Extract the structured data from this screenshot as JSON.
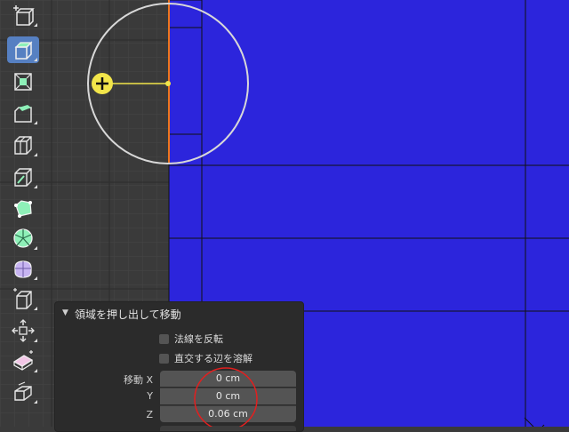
{
  "colors": {
    "viewport_bg": "#3a3a3a",
    "face_blue": "#2c25dc",
    "edge_black": "#111111",
    "active_tool": "#5680c2",
    "gizmo_yellow": "#f2e54a",
    "annotation_red": "#e21f1f"
  },
  "toolbar": {
    "tools": [
      {
        "icon": "add-cube-icon",
        "active": false
      },
      {
        "icon": "extrude-region-icon",
        "active": true
      },
      {
        "icon": "inset-faces-icon",
        "active": false
      },
      {
        "icon": "bevel-icon",
        "active": false
      },
      {
        "icon": "loop-cut-icon",
        "active": false
      },
      {
        "icon": "knife-icon",
        "active": false
      },
      {
        "icon": "poly-build-icon",
        "active": false
      },
      {
        "icon": "spin-icon",
        "active": false
      },
      {
        "icon": "smooth-icon",
        "active": false
      },
      {
        "icon": "edge-slide-icon",
        "active": false
      },
      {
        "icon": "shrink-fatten-icon",
        "active": false
      },
      {
        "icon": "shear-icon",
        "active": false
      },
      {
        "icon": "rip-region-icon",
        "active": false
      }
    ]
  },
  "panel": {
    "title": "領域を押し出して移動",
    "flip_normals_label": "法線を反転",
    "dissolve_edges_label": "直交する辺を溶解",
    "move_label": "移動 X",
    "y_label": "Y",
    "z_label": "Z",
    "x_value": "0 cm",
    "y_value": "0 cm",
    "z_value": "0.06 cm"
  }
}
